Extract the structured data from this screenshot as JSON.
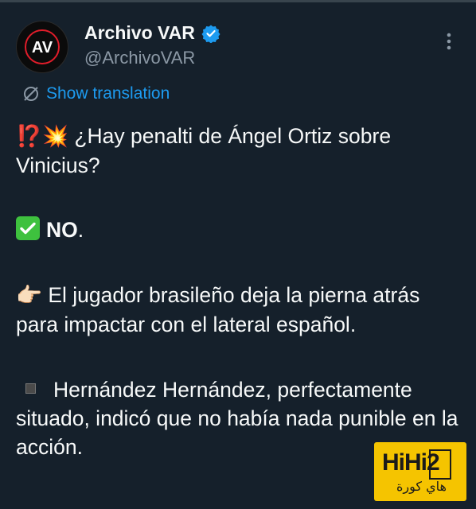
{
  "author": {
    "display_name": "Archivo VAR",
    "handle": "@ArchivoVAR",
    "avatar_text": "AV",
    "verified": true
  },
  "translate": {
    "label": "Show translation"
  },
  "tweet": {
    "p1_emoji": "⁉️💥",
    "p1_text": " ¿Hay penalti de Ángel Ortiz sobre Vinicius?",
    "p2_text": "NO",
    "p2_suffix": ".",
    "p3_emoji": "👉🏻",
    "p3_text": " El jugador brasileño deja la pierna atrás para impactar con el lateral español.",
    "p4_text": "Hernández Hernández, perfectamente situado, indicó que no había nada punible en la acción."
  },
  "watermark": {
    "brand": "HiHi2",
    "subtitle": "هاي كورة"
  },
  "colors": {
    "background": "#15202b",
    "accent": "#1d9bf0",
    "muted": "#8b98a5",
    "watermark": "#f5c400"
  },
  "icons": [
    "verified-badge-icon",
    "more-options-icon",
    "translate-globe-icon",
    "check-mark-icon"
  ]
}
